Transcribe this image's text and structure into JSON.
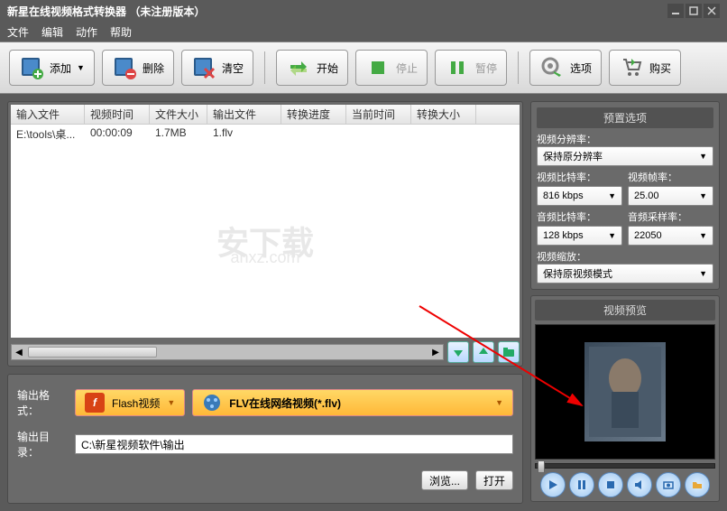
{
  "titlebar": {
    "title": "新星在线视频格式转换器  （未注册版本）"
  },
  "menu": {
    "file": "文件",
    "edit": "编辑",
    "action": "动作",
    "help": "帮助"
  },
  "toolbar": {
    "add": "添加",
    "delete": "删除",
    "clear": "清空",
    "start": "开始",
    "stop": "停止",
    "pause": "暂停",
    "options": "选项",
    "buy": "购买"
  },
  "table": {
    "headers": {
      "input": "输入文件",
      "vtime": "视频时间",
      "fsize": "文件大小",
      "output": "输出文件",
      "progress": "转换进度",
      "curtime": "当前时间",
      "csize": "转换大小"
    },
    "rows": [
      {
        "input": "E:\\tools\\桌...",
        "vtime": "00:00:09",
        "fsize": "1.7MB",
        "output": "1.flv",
        "progress": "",
        "curtime": "",
        "csize": ""
      }
    ]
  },
  "watermark": {
    "main": "安下载",
    "sub": "anxz.com"
  },
  "output": {
    "format_label": "输出格式：",
    "format_type": "Flash视频",
    "format_detail": "FLV在线网络视频(*.flv)",
    "dir_label": "输出目录：",
    "dir_value": "C:\\新星视频软件\\输出",
    "browse": "浏览...",
    "open": "打开"
  },
  "preset": {
    "title": "预置选项",
    "res_label": "视频分辨率：",
    "res_value": "保持原分辨率",
    "vbitrate_label": "视频比特率：",
    "vbitrate_value": "816 kbps",
    "vfps_label": "视频帧率：",
    "vfps_value": "25.00",
    "abitrate_label": "音频比特率：",
    "abitrate_value": "128 kbps",
    "asample_label": "音频采样率：",
    "asample_value": "22050",
    "scale_label": "视频缩放：",
    "scale_value": "保持原视频模式"
  },
  "preview": {
    "title": "视频预览"
  },
  "colwidths": {
    "input": 82,
    "vtime": 72,
    "fsize": 64,
    "output": 82,
    "progress": 72,
    "curtime": 72,
    "csize": 72
  }
}
